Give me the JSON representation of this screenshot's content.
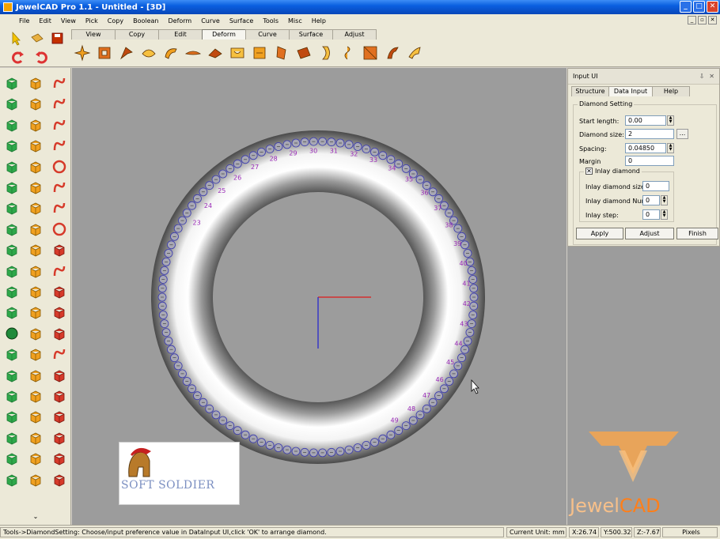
{
  "window": {
    "title": "JewelCAD Pro 1.1 - Untitled - [3D]"
  },
  "menu": [
    "File",
    "Edit",
    "View",
    "Pick",
    "Copy",
    "Boolean",
    "Deform",
    "Curve",
    "Surface",
    "Tools",
    "Misc",
    "Help"
  ],
  "tool_tabs": [
    "View",
    "Copy",
    "Edit",
    "Deform",
    "Curve",
    "Surface",
    "Adjust"
  ],
  "active_tool_tab": "Deform",
  "deform_icons": [
    "move-icon",
    "scale-icon",
    "rotate-icon",
    "twist-icon",
    "bend-icon",
    "taper-icon",
    "shear-icon",
    "project-icon",
    "flatten-icon",
    "warp-icon",
    "stretch-icon",
    "bulge-icon",
    "spiral-icon",
    "mirror-icon",
    "curve-deform-icon",
    "path-deform-icon"
  ],
  "ring_labels": [
    "23",
    "24",
    "25",
    "26",
    "27",
    "28",
    "29",
    "30",
    "31",
    "32",
    "33",
    "34",
    "35",
    "36",
    "37",
    "38",
    "39",
    "40",
    "41",
    "42",
    "43",
    "44",
    "45",
    "46",
    "47",
    "48",
    "49"
  ],
  "panel": {
    "title": "Input UI",
    "pin": "⇩",
    "close": "✕",
    "tabs": [
      "Structure",
      "Data Input",
      "Help"
    ],
    "active_tab": "Data Input",
    "group_title": "Diamond Setting",
    "start_length_label": "Start length:",
    "start_length_value": "0.00",
    "diamond_size_label": "Diamond size:",
    "diamond_size_value": "2",
    "dots_label": "...",
    "spacing_label": "Spacing:",
    "spacing_value": "0.04850",
    "margin_label": "Margin",
    "margin_value": "0",
    "inlay_checkbox_label": "Inlay diamond",
    "inlay_checked_mark": "✕",
    "inlay_size_label": "Inlay diamond size:",
    "inlay_size_value": "0",
    "inlay_num_label": "Inlay diamond Num:",
    "inlay_num_value": "0",
    "inlay_step_label": "Inlay step:",
    "inlay_step_value": "0",
    "apply_label": "Apply",
    "adjust_label": "Adjust",
    "finish_label": "Finish"
  },
  "watermark": {
    "soft_soldier": "SOFT SOLDIER",
    "jewel": "Jewel",
    "cad": "CAD"
  },
  "status": {
    "message": "Tools->DiamondSetting: Choose/input preference value in DataInput UI,click 'OK' to arrange diamond.",
    "unit": "Current Unit:  mm",
    "x": "X:26.74",
    "y": "Y:500.32",
    "z": "Z:-7.67",
    "pixels": "Pixels"
  },
  "colors": {
    "title_bar": "#0a5fe0",
    "viewport": "#9c9c9c",
    "diamond_outline": "#3a3ab0",
    "label": "#9a2ab8",
    "axis_x": "#e01818",
    "axis_y": "#2020d0"
  }
}
